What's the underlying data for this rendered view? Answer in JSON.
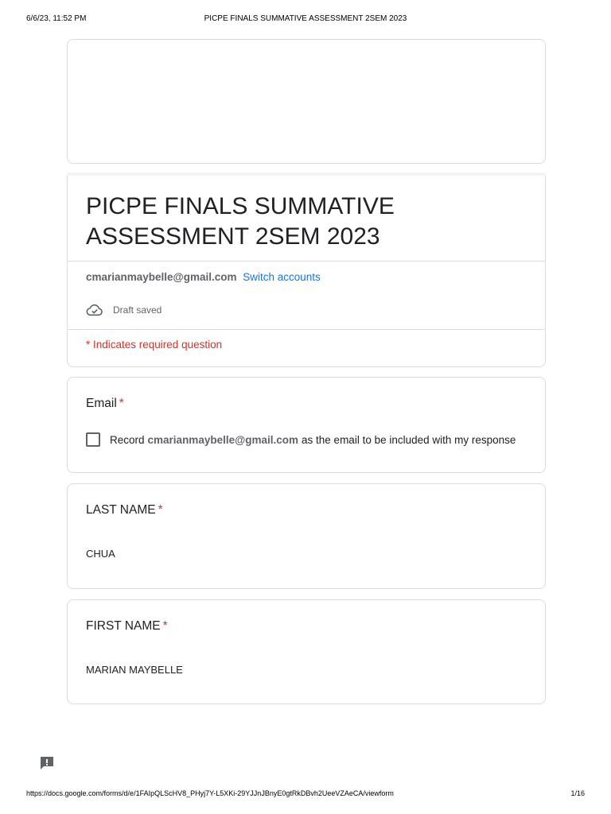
{
  "print": {
    "date": "6/6/23, 11:52 PM",
    "doc_title": "PICPE FINALS SUMMATIVE ASSESSMENT 2SEM 2023",
    "url": "https://docs.google.com/forms/d/e/1FAIpQLScHV8_PHyj7Y-L5XKi-29YJJnJBnyE0gtRkDBvh2UeeVZAeCA/viewform",
    "page": "1/16"
  },
  "form": {
    "title": "PICPE FINALS SUMMATIVE ASSESSMENT 2SEM 2023",
    "account_email": "cmarianmaybelle@gmail.com",
    "switch_accounts": "Switch accounts",
    "draft_status": "Draft saved",
    "required_note": "* Indicates required question"
  },
  "questions": {
    "email": {
      "label": "Email",
      "required_mark": "*",
      "checkbox_prefix": "Record",
      "checkbox_email": "cmarianmaybelle@gmail.com",
      "checkbox_suffix": "as the email to be included with my response",
      "checked": false
    },
    "last_name": {
      "label": "LAST NAME",
      "required_mark": "*",
      "value": "CHUA"
    },
    "first_name": {
      "label": "FIRST NAME",
      "required_mark": "*",
      "value": "MARIAN MAYBELLE"
    }
  },
  "icons": {
    "draft": "cloud-check-icon",
    "feedback": "feedback-icon"
  },
  "colors": {
    "accent": "#1a73e8",
    "required": "#d93025",
    "border": "#dadce0"
  }
}
